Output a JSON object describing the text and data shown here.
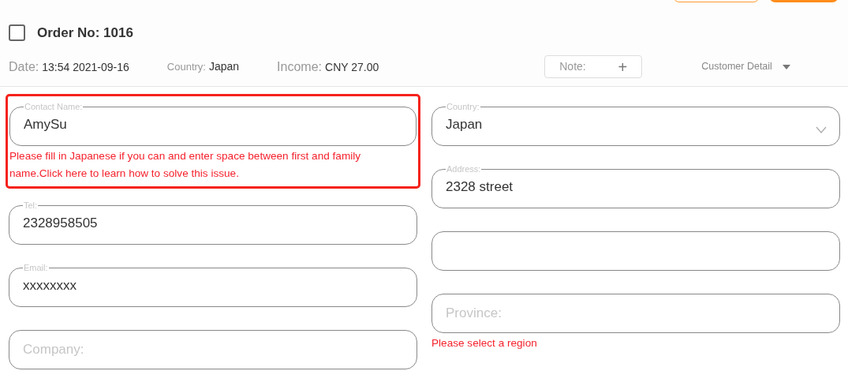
{
  "order": {
    "checked": false,
    "title": "Order No: 1016"
  },
  "meta": [
    {
      "label": "Date:",
      "value": "13:54 2021-09-16",
      "kind": "large"
    },
    {
      "label": "Country:",
      "value": "Japan",
      "kind": "small"
    },
    {
      "label": "Income:",
      "value": "CNY 27.00",
      "kind": "large"
    }
  ],
  "note": {
    "label": "Note:",
    "icon": "+"
  },
  "customer_detail": {
    "label": "Customer Detail",
    "expanded": false
  },
  "left_fields": [
    {
      "kind": "text",
      "label": "Contact Name:",
      "value": "AmySu",
      "highlighted": true,
      "error": {
        "before": "Please fill in Japanese if you can and enter space between first and family name.Click",
        "link": "here",
        "after": "to learn how to solve this issue."
      }
    },
    {
      "kind": "text",
      "label": "Tel:",
      "value": "2328958505"
    },
    {
      "kind": "text",
      "label": "Email:",
      "value": "xxxxxxxx"
    },
    {
      "kind": "text",
      "placeholder": "Company:"
    }
  ],
  "right_fields": [
    {
      "kind": "select",
      "label": "Country:",
      "value": "Japan"
    },
    {
      "kind": "text",
      "label": "Address:",
      "value": "2328 street"
    },
    {
      "kind": "text"
    },
    {
      "kind": "text",
      "placeholder": "Province:",
      "error": {
        "before": "Please select a region"
      }
    }
  ]
}
